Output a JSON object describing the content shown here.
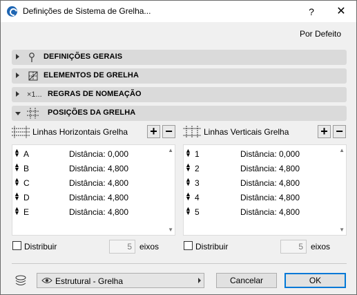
{
  "window": {
    "title": "Definições de Sistema de Grelha...",
    "help": "?",
    "close": "✕"
  },
  "default_link": "Por Defeito",
  "sections": [
    {
      "label": "DEFINIÇÕES GERAIS",
      "icon": "pin-icon",
      "expanded": false
    },
    {
      "label": "ELEMENTOS DE GRELHA",
      "icon": "grid-element-icon",
      "expanded": false
    },
    {
      "label": "REGRAS DE NOMEAÇÃO",
      "icon": "naming-icon",
      "icon_text": "×1...",
      "expanded": false
    },
    {
      "label": "POSIÇÕES DA GRELHA",
      "icon": "grid-positions-icon",
      "expanded": true
    }
  ],
  "horizontal": {
    "title": "Linhas Horizontais Grelha",
    "add": "+",
    "remove": "−",
    "rows": [
      {
        "name": "A",
        "label": "Distância:",
        "value": "0,000"
      },
      {
        "name": "B",
        "label": "Distância:",
        "value": "4,800"
      },
      {
        "name": "C",
        "label": "Distância:",
        "value": "4,800"
      },
      {
        "name": "D",
        "label": "Distância:",
        "value": "4,800"
      },
      {
        "name": "E",
        "label": "Distância:",
        "value": "4,800"
      }
    ],
    "distribute_label": "Distribuir",
    "distribute_checked": false,
    "axes_count": "5",
    "axes_label": "eixos"
  },
  "vertical": {
    "title": "Linhas Verticais Grelha",
    "add": "+",
    "remove": "−",
    "rows": [
      {
        "name": "1",
        "label": "Distância:",
        "value": "0,000"
      },
      {
        "name": "2",
        "label": "Distância:",
        "value": "4,800"
      },
      {
        "name": "3",
        "label": "Distância:",
        "value": "4,800"
      },
      {
        "name": "4",
        "label": "Distância:",
        "value": "4,800"
      },
      {
        "name": "5",
        "label": "Distância:",
        "value": "4,800"
      }
    ],
    "distribute_label": "Distribuir",
    "distribute_checked": false,
    "axes_count": "5",
    "axes_label": "eixos"
  },
  "footer": {
    "layer": "Estrutural - Grelha",
    "cancel": "Cancelar",
    "ok": "OK"
  },
  "colors": {
    "section_bg": "#dadada",
    "ok_border": "#0078d7",
    "app_icon": "#1f66b3"
  }
}
